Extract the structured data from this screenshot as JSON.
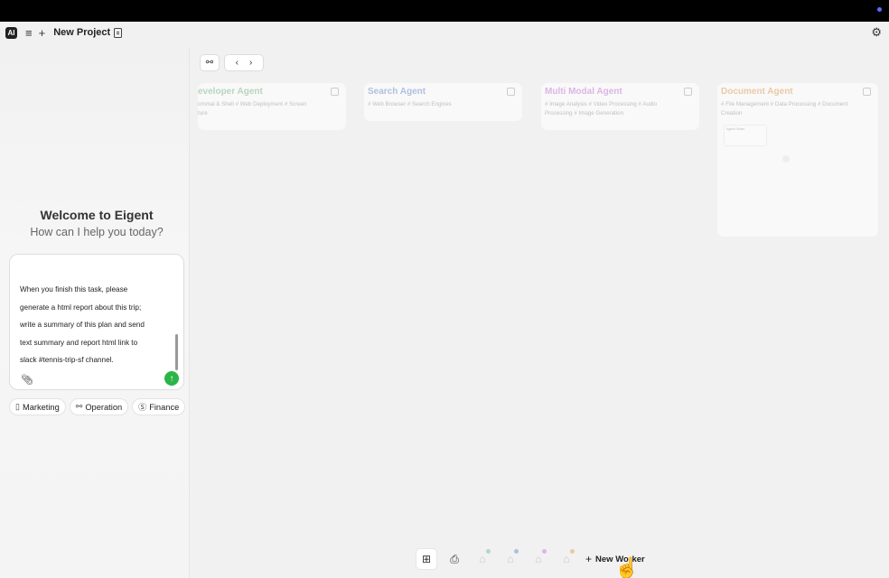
{
  "app": {
    "project_title": "New Project",
    "logo_text": "AI"
  },
  "welcome": {
    "title": "Welcome to Eigent",
    "subtitle": "How can I help you today?"
  },
  "chat": {
    "lines": [
      "When you finish this task, please",
      "generate a html report about this trip;",
      "write a summary of this plan and send",
      "text summary and report html link to",
      "slack #tennis-trip-sf channel."
    ]
  },
  "chips": [
    {
      "label": "Marketing",
      "icon": "phone-icon"
    },
    {
      "label": "Operation",
      "icon": "nodes-icon"
    },
    {
      "label": "Finance",
      "icon": "dollar-icon"
    }
  ],
  "agents": [
    {
      "name": "eveloper Agent",
      "color": "#b7d6bf",
      "tags": "ommal & Shell # Web Deployment # Screen\nture"
    },
    {
      "name": "Search Agent",
      "color": "#b0bfe0",
      "tags": "# Web Browser # Search Engines"
    },
    {
      "name": "Multi Modal Agent",
      "color": "#dcb5e6",
      "tags": "# Image Analysis # Video Processing # Audio\nProcessing # Image Generation"
    },
    {
      "name": "Document Agent",
      "color": "#ecc9a6",
      "tags": "# File Management # Data Processing # Document\nCreation"
    }
  ],
  "mini_doc_title": "Agent Folder",
  "bottom_bar": {
    "new_worker_label": "New Worker",
    "badge_colors": [
      "#b7d6bf",
      "#b0bfe0",
      "#dcb5e6",
      "#ecc9a6"
    ]
  }
}
